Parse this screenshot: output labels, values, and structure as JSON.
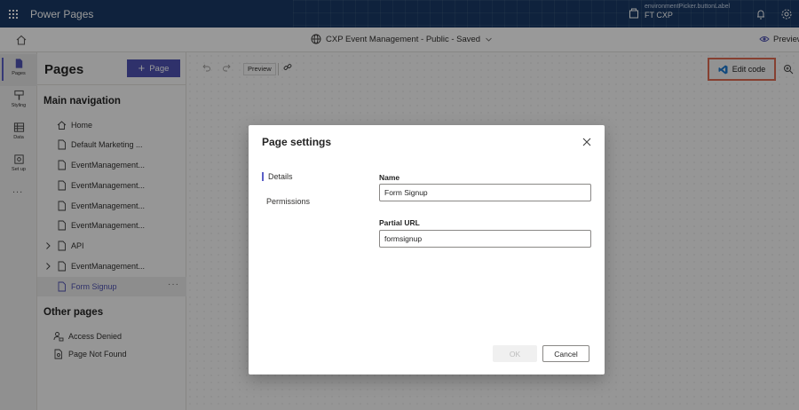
{
  "header": {
    "app_name": "Power Pages",
    "env_label_small": "environmentPicker.buttonLabel",
    "env_name": "FT CXP"
  },
  "commandbar": {
    "site_title": "CXP Event Management - Public - Saved",
    "preview_label": "Preview"
  },
  "rail": {
    "items": [
      {
        "label": "Pages",
        "icon": "pages-icon",
        "active": true
      },
      {
        "label": "Styling",
        "icon": "styling-icon"
      },
      {
        "label": "Data",
        "icon": "data-icon"
      },
      {
        "label": "Set up",
        "icon": "setup-icon"
      }
    ],
    "more": "..."
  },
  "pages_panel": {
    "title": "Pages",
    "add_button": "Page",
    "main_nav_title": "Main navigation",
    "items": [
      {
        "label": "Home",
        "icon": "home-icon"
      },
      {
        "label": "Default Marketing ...",
        "icon": "page-icon"
      },
      {
        "label": "EventManagement...",
        "icon": "page-icon"
      },
      {
        "label": "EventManagement...",
        "icon": "page-icon"
      },
      {
        "label": "EventManagement...",
        "icon": "page-icon"
      },
      {
        "label": "EventManagement...",
        "icon": "page-icon"
      },
      {
        "label": "API",
        "icon": "page-icon",
        "expandable": true
      },
      {
        "label": "EventManagement...",
        "icon": "page-icon",
        "expandable": true
      },
      {
        "label": "Form Signup",
        "icon": "page-icon",
        "selected": true,
        "more": "···"
      }
    ],
    "other_title": "Other pages",
    "other_items": [
      {
        "label": "Access Denied",
        "icon": "user-lock-icon"
      },
      {
        "label": "Page Not Found",
        "icon": "page-search-icon"
      }
    ]
  },
  "toolbar": {
    "preview_label": "Preview",
    "edit_code_label": "Edit code"
  },
  "dialog": {
    "title": "Page settings",
    "tabs": [
      "Details",
      "Permissions"
    ],
    "active_tab": "Details",
    "name_label": "Name",
    "name_value": "Form Signup",
    "url_label": "Partial URL",
    "url_value": "formsignup",
    "ok_label": "OK",
    "cancel_label": "Cancel"
  },
  "colors": {
    "header_bg": "#1a3a66",
    "accent": "#4f52b2",
    "highlight_border": "#e06b53"
  }
}
